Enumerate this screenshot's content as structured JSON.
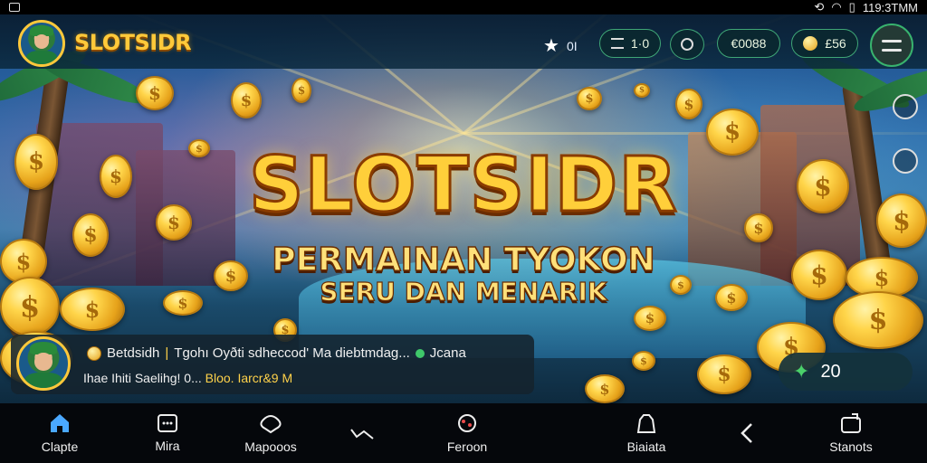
{
  "status_bar": {
    "time": "119:3TMM"
  },
  "header": {
    "logo": "SLOTSIDR",
    "stars": "0I",
    "level": "1·0",
    "currency": "€0088",
    "gems": "£56"
  },
  "banner": {
    "title": "SLOTSIDR",
    "subtitle_line1": "PERMAINAN TYOKON",
    "subtitle_line2": "SERU DAN MENARIK"
  },
  "notification": {
    "name": "Betdsidh",
    "separator": "|",
    "message": "Tgohı Oyðti sdheccod' Ma diebtmdag...",
    "status": "Jcana",
    "line2_prefix": "Ihae",
    "line2_text": "Ihiti Saelihg! 0...",
    "line2_highlight": "Bloo. Iarcr&9 M"
  },
  "score": {
    "value": "20"
  },
  "bottom_nav": {
    "items": [
      {
        "label": "Clapte",
        "icon": "home-icon"
      },
      {
        "label": "Mira",
        "icon": "chat-icon"
      },
      {
        "label": "Mapooos",
        "icon": "map-icon"
      },
      {
        "label": "Feroon",
        "icon": "reward-icon"
      },
      {
        "label": "Biaiata",
        "icon": "bag-icon"
      },
      {
        "label": "Stanots",
        "icon": "stats-icon"
      }
    ]
  },
  "colors": {
    "accent": "#3fa676",
    "gold": "#ffcf3a",
    "nav_active": "#4aa8ff"
  }
}
